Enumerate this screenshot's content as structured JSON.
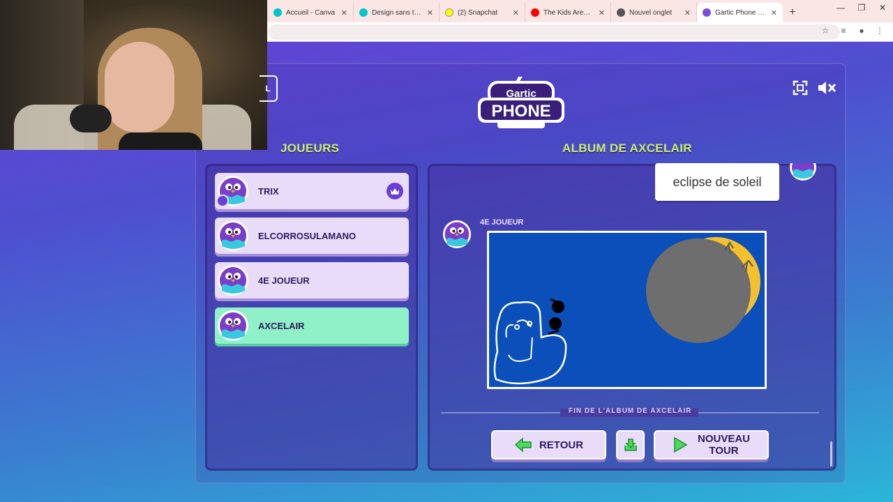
{
  "browser": {
    "tabs": [
      {
        "title": "Accueil - Canva",
        "color": "#00c4cc",
        "active": false
      },
      {
        "title": "Design sans titre - Ba",
        "color": "#00c4cc",
        "active": false
      },
      {
        "title": "(2) Snapchat",
        "color": "#fffc00",
        "active": false
      },
      {
        "title": "The Kids Aren't A",
        "color": "#ff0000",
        "active": false
      },
      {
        "title": "Nouvel onglet",
        "color": "#555555",
        "active": false
      },
      {
        "title": "Gartic Phone - Le jeu",
        "color": "#7a4cd8",
        "active": true
      }
    ],
    "new_tab": "+",
    "tab_close": "✕",
    "window_controls": [
      "—",
      "❐",
      "✕"
    ]
  },
  "game": {
    "logo_top": "Gartic",
    "logo_bottom": "PHONE",
    "edge_button": "L",
    "players_title": "JOUEURS",
    "album_title": "ALBUM DE AXCELAIR",
    "players": [
      {
        "name": "TRIX",
        "host": true,
        "me": false
      },
      {
        "name": "ELCORROSULAMANO",
        "host": false,
        "me": false
      },
      {
        "name": "4E JOUEUR",
        "host": false,
        "me": false
      },
      {
        "name": "AXCELAIR",
        "host": false,
        "me": true
      }
    ],
    "album": {
      "prompt_text": "eclipse de soleil",
      "drawing_author": "4E JOUEUR",
      "end_label": "FIN DE L'ALBUM DE AXCELAIR"
    },
    "buttons": {
      "back": "RETOUR",
      "new_round_line1": "NOUVEAU",
      "new_round_line2": "TOUR"
    },
    "colors": {
      "accent_green": "#c8f06a",
      "panel_purple": "#463296",
      "drawing_bg": "#0b4fba",
      "moon_yellow": "#f5c02c",
      "eclipse_grey": "#6e6e6e"
    },
    "icons": [
      "fullscreen-icon",
      "mute-icon",
      "crown-icon",
      "user-icon",
      "arrow-left-icon",
      "download-icon",
      "play-icon"
    ]
  }
}
